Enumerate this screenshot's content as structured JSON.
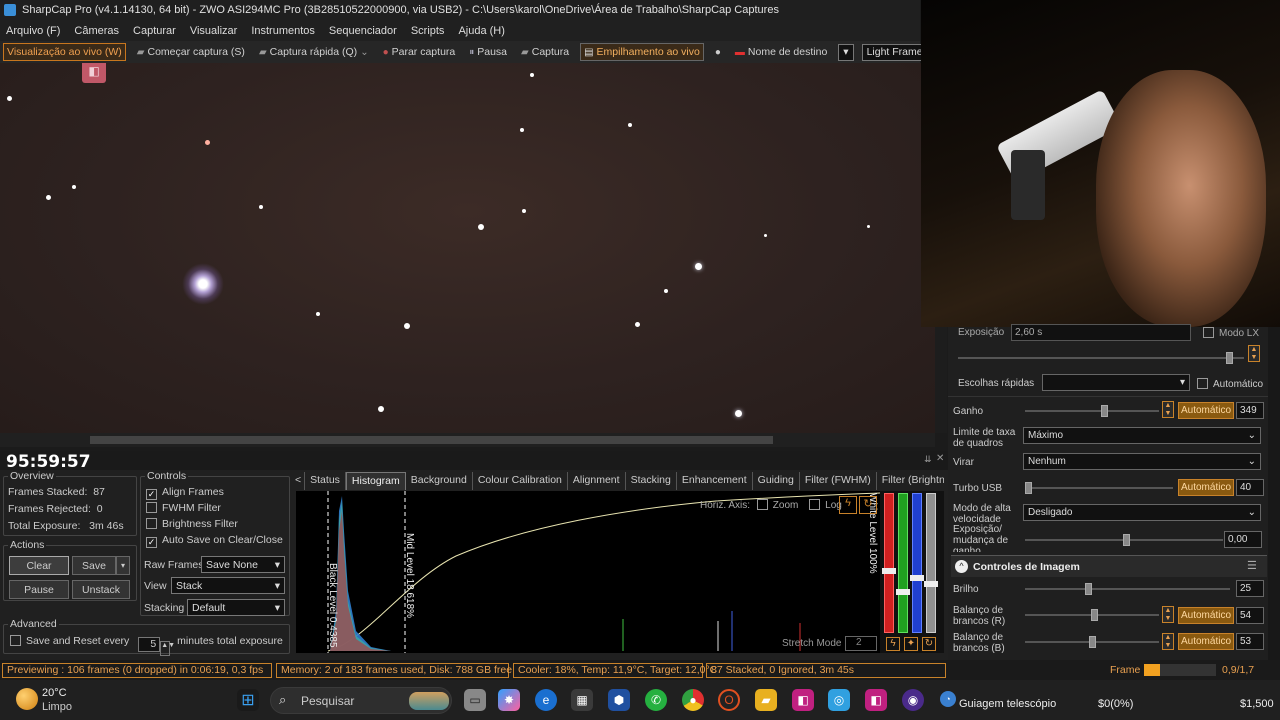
{
  "window": {
    "title": "SharpCap Pro (v4.1.14130, 64 bit) - ZWO ASI294MC Pro (3B28510522000900, via USB2) - C:\\Users\\karol\\OneDrive\\Área de Trabalho\\SharpCap Captures"
  },
  "menu": [
    "Arquivo (F)",
    "Câmeras",
    "Capturar",
    "Visualizar",
    "Instrumentos",
    "Sequenciador",
    "Scripts",
    "Ajuda (H)"
  ],
  "toolbar": {
    "live_view": "Visualização ao vivo (W)",
    "start_capture": "Começar captura (S)",
    "quick_capture": "Captura rápida (Q)",
    "stop_capture": "Parar captura",
    "pause": "Pausa",
    "capture": "Captura",
    "live_stack": "Empilhamento ao vivo",
    "target_name": "Nome de destino",
    "target_value": "",
    "frame_type": "Light Frames"
  },
  "clock": "95:59:57",
  "overview": {
    "title": "Overview",
    "frames_stacked_label": "Frames Stacked:",
    "frames_stacked": "87",
    "frames_rejected_label": "Frames Rejected:",
    "frames_rejected": "0",
    "total_exposure_label": "Total Exposure:",
    "total_exposure": "3m 46s"
  },
  "actions": {
    "title": "Actions",
    "clear": "Clear",
    "save": "Save",
    "pause": "Pause",
    "unstack": "Unstack"
  },
  "advanced": {
    "title": "Advanced",
    "save_reset_label": "Save and Reset every",
    "save_reset_value": "5",
    "suffix": "minutes total exposure"
  },
  "controls": {
    "title": "Controls",
    "align_frames": "Align Frames",
    "fwhm_filter": "FWHM Filter",
    "brightness_filter": "Brightness Filter",
    "auto_save": "Auto Save on Clear/Close",
    "raw_frames_label": "Raw Frames",
    "raw_frames_value": "Save None",
    "view_label": "View",
    "view_value": "Stack",
    "stacking_label": "Stacking",
    "stacking_value": "Default"
  },
  "tabs": [
    "Status",
    "Histogram",
    "Background",
    "Colour Calibration",
    "Alignment",
    "Stacking",
    "Enhancement",
    "Guiding",
    "Filter (FWHM)",
    "Filter (Brightness)",
    "D"
  ],
  "histogram": {
    "horiz_axis": "Horiz. Axis:",
    "zoom": "Zoom",
    "log": "Log",
    "black_level": "Black Level 0.4385",
    "mid_level": "Mid Level 18.618%",
    "white_level": "White Level 100%",
    "stretch_mode": "Stretch Mode",
    "stretch_value": "2"
  },
  "camera_controls": {
    "exposure_label": "Exposição",
    "exposure_value": "2,60 s",
    "lx_mode": "Modo LX",
    "quick_picks_label": "Escolhas rápidas",
    "auto_label": "Automático",
    "gain_label": "Ganho",
    "gain_auto": "Automático",
    "gain_value": "349",
    "frame_rate_label": "Limite de taxa de quadros",
    "frame_rate_value": "Máximo",
    "flip_label": "Virar",
    "flip_value": "Nenhum",
    "usb_label": "Turbo USB",
    "usb_auto": "Automático",
    "usb_value": "40",
    "hs_label": "Modo de alta velocidade",
    "hs_value": "Desligado",
    "exp_change_label": "Exposição/ mudança de ganho",
    "exp_change_value": "0,00"
  },
  "image_controls": {
    "title": "Controles de Imagem",
    "brightness_label": "Brilho",
    "brightness_value": "25",
    "wb_r_label": "Balanço de brancos (R)",
    "wb_r_auto": "Automático",
    "wb_r_value": "54",
    "wb_b_label": "Balanço de brancos (B)",
    "wb_b_auto": "Automático",
    "wb_b_value": "53"
  },
  "statusbar": {
    "previewing": "Previewing : 106 frames (0 dropped) in 0:06:19, 0,3 fps",
    "memory": "Memory: 2 of 183 frames used, Disk: 788 GB free",
    "cooler": "Cooler: 18%, Temp: 11,9°C, Target: 12,0°C",
    "stacked": "87 Stacked, 0 Ignored, 3m 45s",
    "frame_label": "Frame :",
    "frame_value": "0,9/1,7",
    "frame_progress": 0.22
  },
  "taskbar": {
    "weather_temp": "20°C",
    "weather_desc": "Limpo",
    "search": "Pesquisar",
    "notif_label": "Guiagem telescópio",
    "notif_value": "$0(0%)",
    "price": "$1,500"
  },
  "colors": {
    "accent": "#c8822a",
    "auto_button": "#8a5a10",
    "background": "#1f1f1f"
  }
}
